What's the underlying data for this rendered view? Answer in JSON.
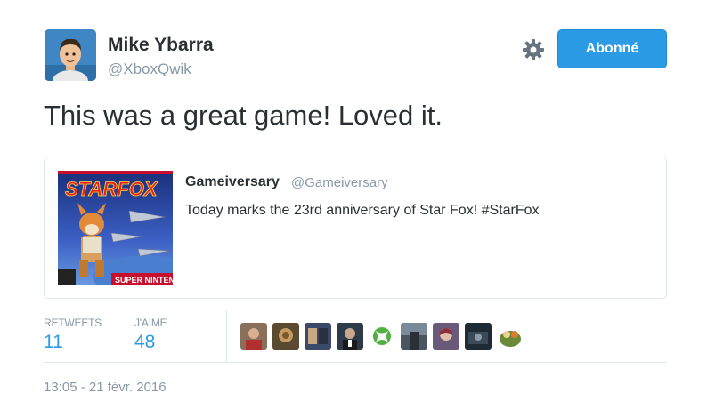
{
  "author": {
    "name": "Mike Ybarra",
    "handle": "@XboxQwik"
  },
  "actions": {
    "follow_label": "Abonné",
    "settings_icon": "gear-icon"
  },
  "tweet": {
    "text": "This was a great game! Loved it."
  },
  "quote": {
    "name": "Gameiversary",
    "handle": "@Gameiversary",
    "text": "Today marks the 23rd anniversary of Star Fox! #StarFox",
    "thumbnail_icon": "star-fox-box-art"
  },
  "stats": {
    "retweets_label": "RETWEETS",
    "retweets_value": "11",
    "likes_label": "J'AIME",
    "likes_value": "48"
  },
  "likers": [
    {
      "icon": "liker-avatar",
      "color": "#8a6f5a"
    },
    {
      "icon": "liker-avatar",
      "color": "#5a4a32"
    },
    {
      "icon": "liker-avatar",
      "color": "#3c4a6a"
    },
    {
      "icon": "liker-avatar",
      "color": "#2e3a48"
    },
    {
      "icon": "xbox-logo-icon",
      "color": "#52b043"
    },
    {
      "icon": "liker-avatar",
      "color": "#4a5560"
    },
    {
      "icon": "liker-avatar",
      "color": "#6a5a7a"
    },
    {
      "icon": "liker-avatar",
      "color": "#1e2a34"
    },
    {
      "icon": "liker-avatar",
      "color": "#6a8a3a"
    }
  ],
  "timestamp": "13:05 - 21 févr. 2016",
  "colors": {
    "accent": "#2b9be6",
    "muted": "#8899a6",
    "text": "#292f33",
    "border": "#e1e8ed"
  }
}
